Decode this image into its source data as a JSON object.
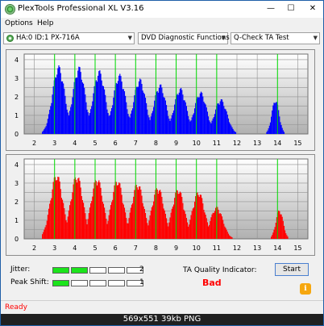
{
  "window": {
    "title": "PlexTools Professional XL V3.16",
    "controls": [
      "—",
      "☐",
      "✕"
    ]
  },
  "menu": [
    {
      "label": "Options",
      "underline": "O"
    },
    {
      "label": "Help",
      "underline": "H"
    }
  ],
  "toolbar": {
    "drive": "HA:0 ID:1  PX-716A",
    "function": "DVD Diagnostic Functions",
    "test": "Q-Check TA Test"
  },
  "charts": {
    "x_ticks": [
      "2",
      "3",
      "4",
      "5",
      "6",
      "7",
      "8",
      "9",
      "10",
      "11",
      "12",
      "13",
      "14",
      "15"
    ],
    "y_ticks": [
      "0",
      "1",
      "2",
      "3",
      "4"
    ],
    "top_color": "#0000ff",
    "bottom_color": "#ff0000",
    "marker_color": "#00dd00"
  },
  "chart_data": [
    {
      "type": "area",
      "series": [
        {
          "values_note_free": true
        }
      ],
      "x_peaks": [
        3.2,
        4.2,
        5.2,
        6.2,
        7.2,
        8.2,
        9.2,
        10.2,
        11.2,
        13.9
      ],
      "peak_heights": [
        3.7,
        3.65,
        3.45,
        3.25,
        3.0,
        2.7,
        2.5,
        2.3,
        1.9,
        1.9
      ],
      "xlim": [
        1.5,
        15.5
      ],
      "ylim": [
        0,
        4.3
      ],
      "markers_x": [
        3,
        4,
        5,
        6,
        7,
        8,
        9,
        10,
        11,
        14
      ],
      "grid": true
    },
    {
      "type": "area",
      "x_peaks": [
        3.1,
        4.1,
        5.1,
        6.1,
        7.1,
        8.1,
        9.1,
        10.1,
        11.0,
        14.1
      ],
      "peak_heights": [
        3.55,
        3.5,
        3.35,
        3.25,
        3.05,
        2.85,
        2.75,
        2.6,
        1.75,
        1.6
      ],
      "xlim": [
        1.5,
        15.5
      ],
      "ylim": [
        0,
        4.3
      ],
      "markers_x": [
        3,
        4,
        5,
        6,
        7,
        8,
        9,
        10,
        11,
        14
      ],
      "grid": true
    }
  ],
  "quality": {
    "jitter_label": "Jitter:",
    "jitter_value": "2",
    "jitter_level": 2,
    "peak_shift_label": "Peak Shift:",
    "peak_shift_value": "1",
    "peak_shift_level": 1,
    "ta_label": "TA Quality Indicator:",
    "ta_result": "Bad",
    "ta_result_color": "#ff0000"
  },
  "buttons": {
    "start": "Start",
    "info": "i"
  },
  "status": {
    "text": "Ready"
  },
  "caption": {
    "text": "569x551  39kb  PNG"
  }
}
